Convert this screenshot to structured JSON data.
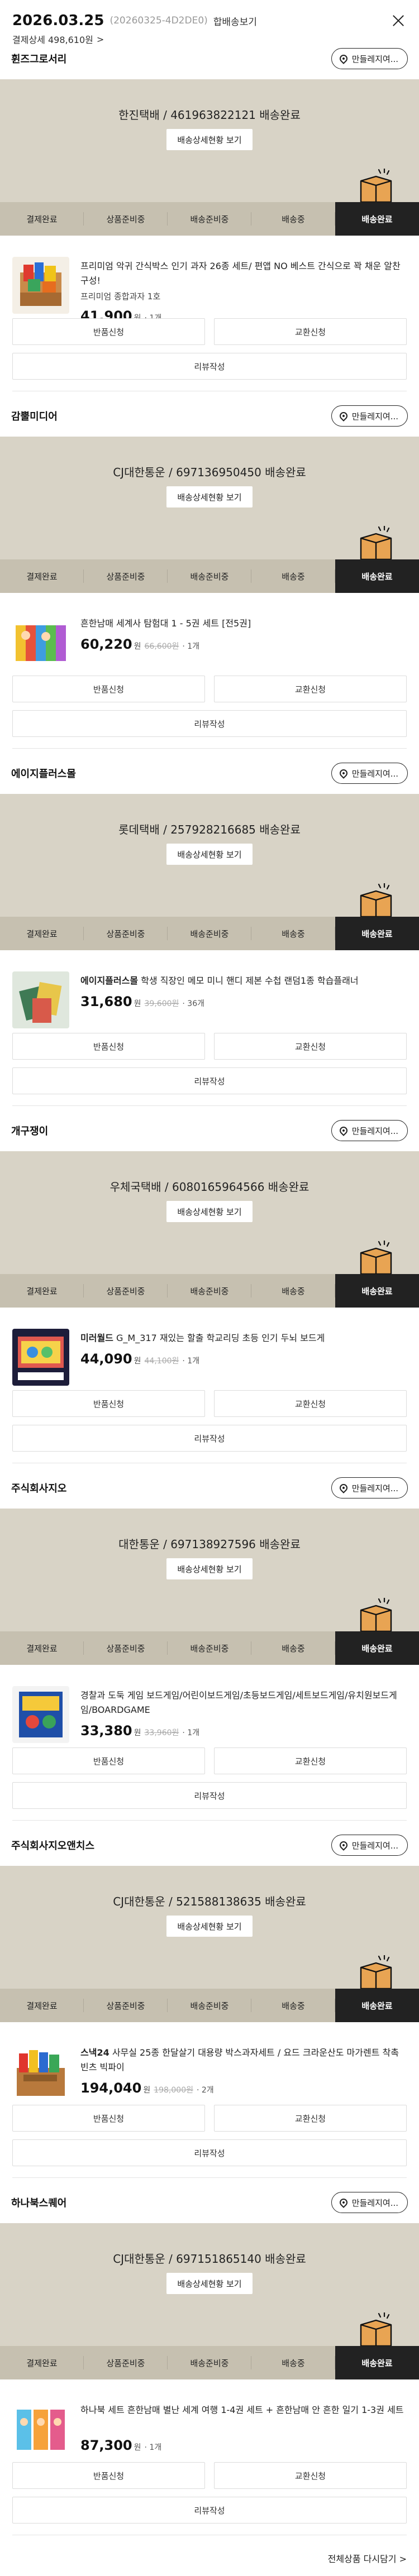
{
  "header": {
    "date": "2026.03.25",
    "order_no": "(20260325-4D2DE0)",
    "combined_label": "합배송보기",
    "payment_label": "결제상세 498,610원",
    "payment_chevron": ">"
  },
  "common": {
    "with_button": "만들레지여...",
    "tracking_button": "배송상세현황 보기",
    "steps": [
      "결제완료",
      "상품준비중",
      "배송준비중",
      "배송중",
      "배송완료"
    ],
    "return_button": "반품신청",
    "exchange_button": "교환신청",
    "review_button": "리뷰작성",
    "won_unit": "원",
    "active_step_color": "#222222",
    "panel_color": "#d8d3c6"
  },
  "shipments": [
    {
      "seller": "휜즈그로서리",
      "carrier_status": "한진택배 / 461963822121 배송완료",
      "product_name": "프리미엄 악귀 간식박스 인기 과자 26종 세트/ 편앱 NO 베스트 간식으로 꽉 채운 알찬 구성!",
      "product_bold": "",
      "option": "프리미엄 종합과자 1호",
      "price": "41,900",
      "original_price": "",
      "quantity": "· 1개",
      "thumb_icon": "snack-box-icon"
    },
    {
      "seller": "감뿔미디어",
      "carrier_status": "CJ대한통운 / 697136950450 배송완료",
      "product_name": "흔한남매 세계사 탐험대 1 - 5권 세트 [전5권]",
      "product_bold": "",
      "option": "",
      "price": "60,220",
      "original_price": "66,600원",
      "quantity": "· 1개",
      "thumb_icon": "book-set-icon"
    },
    {
      "seller": "에이지플러스몰",
      "carrier_status": "롯데택배 / 257928216685 배송완료",
      "product_name": "학생 직장인 메모 미니 핸디 제본 수첩 랜덤1종 학습플래너",
      "product_bold": "에이지플러스몰",
      "option": "",
      "price": "31,680",
      "original_price": "39,600원",
      "quantity": "· 36개",
      "thumb_icon": "notebook-icon"
    },
    {
      "seller": "개구쟁이",
      "carrier_status": "우체국택배 / 6080165964566 배송완료",
      "product_name": "G_M_317 재있는 할출 학교리딩 초등 인기 두뇌 보드게",
      "product_bold": "미러월드",
      "option": "",
      "price": "44,090",
      "original_price": "44,100원",
      "quantity": "· 1개",
      "thumb_icon": "board-game-icon"
    },
    {
      "seller": "주식회사지오",
      "carrier_status": "대한통운 / 697138927596 배송완료",
      "product_name": "경찰과 도둑 게임 보드게임/어린이보드게임/초등보드게임/세트보드게임/유치원보드게임/BOARDGAME",
      "product_bold": "",
      "option": "",
      "price": "33,380",
      "original_price": "33,960원",
      "quantity": "· 1개",
      "thumb_icon": "game-box-icon"
    },
    {
      "seller": "주식회사지오앤치스",
      "carrier_status": "CJ대한통운 / 521588138635 배송완료",
      "product_name": "사무실 25종 한달살기 대용량 박스과자세트 / 요드 크라운산도 마가렌트 착촉빈츠 빅파이",
      "product_bold": "스낵24",
      "option": "",
      "price": "194,040",
      "original_price": "198,000원",
      "quantity": "· 2개",
      "thumb_icon": "snack-bundle-icon"
    },
    {
      "seller": "하나북스퀘어",
      "carrier_status": "CJ대한통운 / 697151865140 배송완료",
      "product_name": "하나북 세트 흔한남매 별난 세계 여행 1-4권 세트 + 흔한남매 안 흔한 일기 1-3권 세트",
      "product_bold": "",
      "option": "",
      "price": "87,300",
      "original_price": "",
      "quantity": "· 1개",
      "thumb_icon": "comic-set-icon"
    }
  ],
  "footer": {
    "rebuy_link": "전체상품 다시담기 >"
  }
}
